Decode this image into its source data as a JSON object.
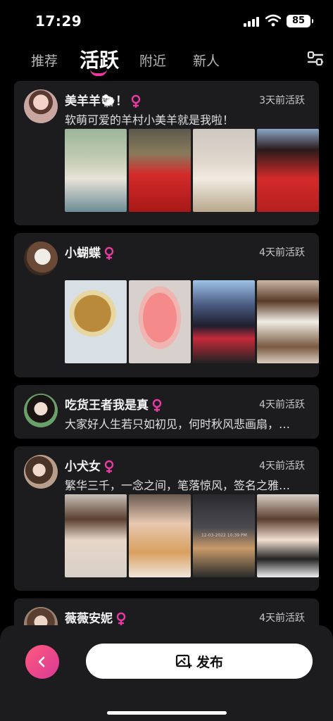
{
  "status": {
    "time": "17:29",
    "battery": "85"
  },
  "tabs": [
    {
      "label": "推荐",
      "active": false
    },
    {
      "label": "活跃",
      "active": true
    },
    {
      "label": "附近",
      "active": false
    },
    {
      "label": "新人",
      "active": false
    }
  ],
  "feed": [
    {
      "name": "美羊羊🐑！",
      "time": "3天前活跃",
      "desc": "软萌可爱的羊村小美羊就是我啦！",
      "photo_count": 4
    },
    {
      "name": "小蝴蝶",
      "time": "4天前活跃",
      "desc": "",
      "photo_count": 4
    },
    {
      "name": "吃货王者我是真",
      "time": "4天前活跃",
      "desc": "大家好人生若只如初见，何时秋风悲画扇，…",
      "photo_count": 0
    },
    {
      "name": "小犬女",
      "time": "4天前活跃",
      "desc": "繁华三千，一念之间，笔落惊风，签名之雅…",
      "photo_count": 4
    },
    {
      "name": "薇薇安妮",
      "time": "4天前活跃",
      "desc": "",
      "photo_count": 0
    }
  ],
  "photo_overlay_text": "12-03-2022 10:39 PM",
  "bottom": {
    "publish_label": "发布"
  },
  "colors": {
    "accent": "#e83aa0",
    "card_bg": "#1c1c1e",
    "page_bg": "#000000"
  },
  "icons": [
    "signal-icon",
    "wifi-icon",
    "battery-icon",
    "filter-icon",
    "female-icon",
    "chevron-left-icon",
    "add-image-icon"
  ]
}
